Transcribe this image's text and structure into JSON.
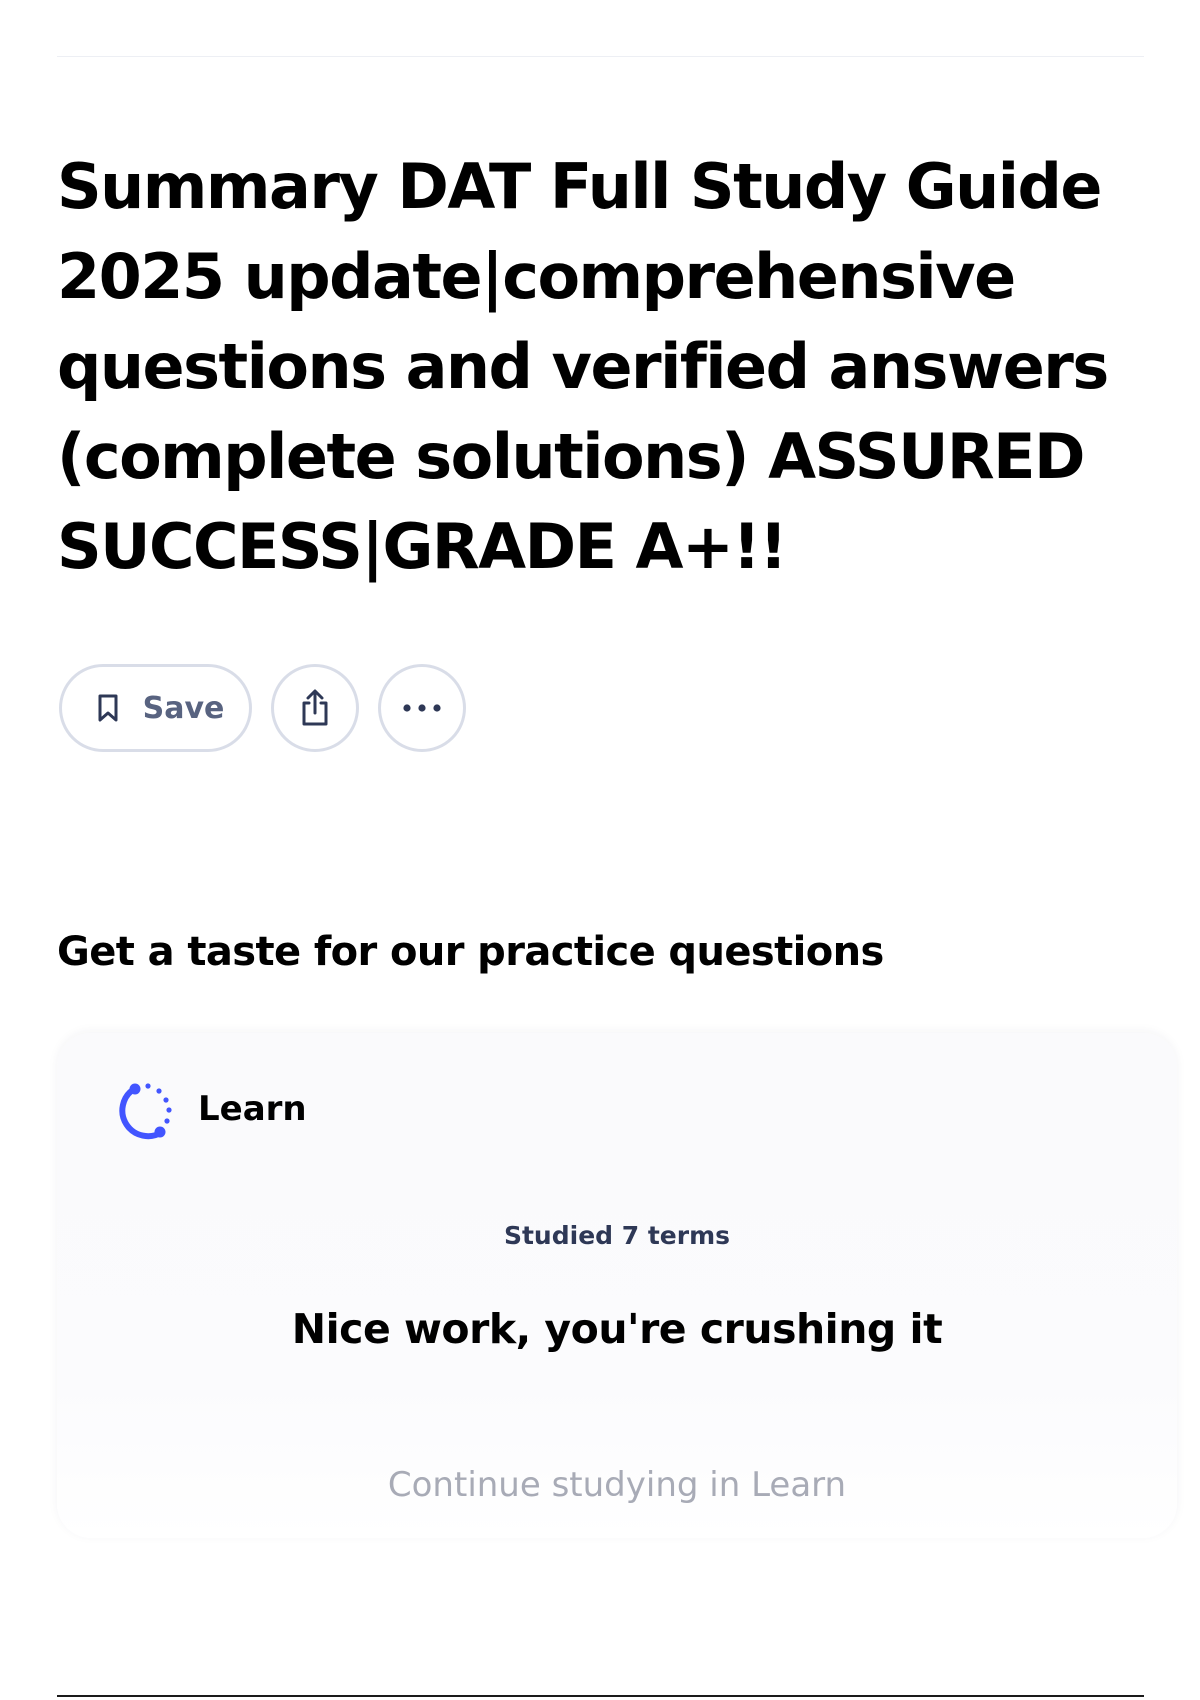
{
  "title": "Summary DAT Full Study Guide 2025 update|comprehensive questions and verified answers (complete solutions) ASSURED SUCCESS|GRADE A+!!",
  "actions": {
    "save_label": "Save",
    "save_icon": "bookmark-icon",
    "share_icon": "share-icon",
    "more_icon": "more-horizontal-icon"
  },
  "practice": {
    "heading": "Get a taste for our practice questions",
    "card": {
      "mode_label": "Learn",
      "mode_icon": "learn-icon",
      "studied_text": "Studied 7 terms",
      "message": "Nice work, you're crushing it",
      "continue_label": "Continue studying in Learn"
    }
  },
  "colors": {
    "text": "#000000",
    "muted": "#586380",
    "accent": "#4255ff",
    "border": "#d9dde8",
    "disabled": "#a8abb6"
  }
}
